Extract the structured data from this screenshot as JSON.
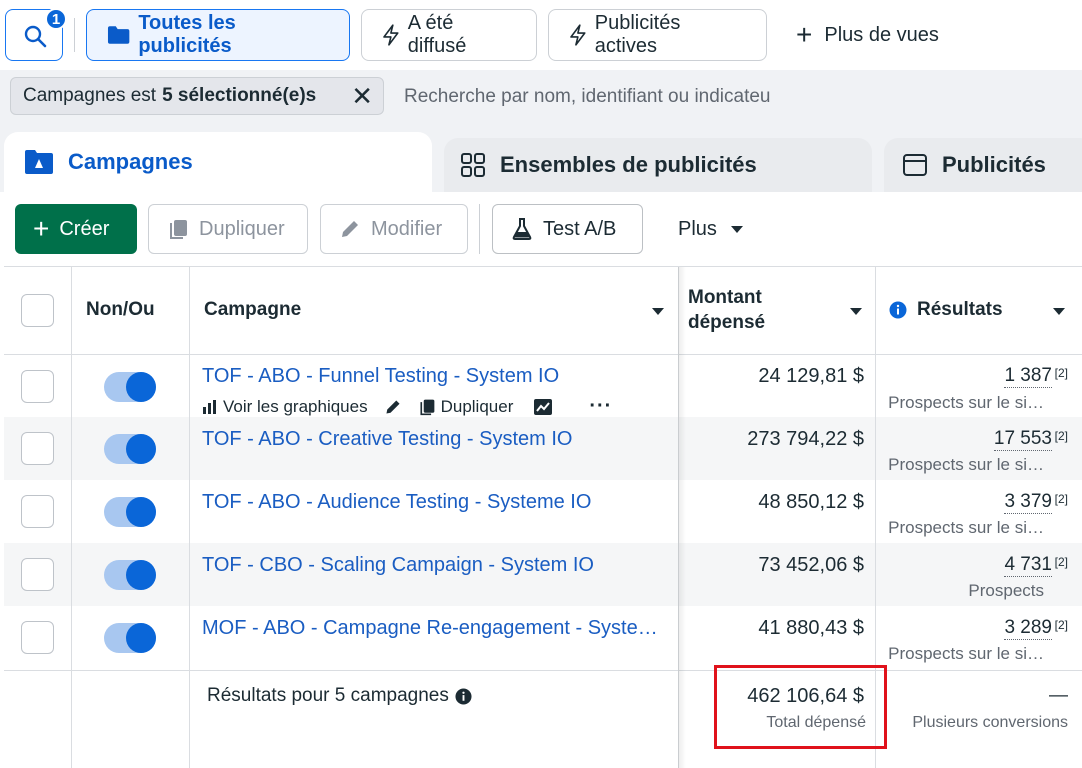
{
  "topbar": {
    "search_badge": "1",
    "views": [
      {
        "label": "Toutes les publicités",
        "icon": "folder-icon"
      },
      {
        "label": "A été diffusé",
        "icon": "lightning-icon"
      },
      {
        "label": "Publicités actives",
        "icon": "lightning-icon"
      }
    ],
    "more_views": "Plus de vues"
  },
  "filter": {
    "chip_prefix": "Campagnes est",
    "chip_value": "5 sélectionné(e)s",
    "search_placeholder": "Recherche par nom, identifiant ou indicateu"
  },
  "tabs": [
    {
      "label": "Campagnes",
      "icon": "campaign-icon",
      "active": true
    },
    {
      "label": "Ensembles de publicités",
      "icon": "grid-icon",
      "active": false
    },
    {
      "label": "Publicités",
      "icon": "ad-frame-icon",
      "active": false
    }
  ],
  "toolbar": {
    "create": "Créer",
    "duplicate": "Dupliquer",
    "edit": "Modifier",
    "ab_test": "Test A/B",
    "more": "Plus"
  },
  "table": {
    "columns": {
      "toggle": "Non/Ou",
      "campaign": "Campagne",
      "spent_line1": "Montant",
      "spent_line2": "dépensé",
      "results": "Résultats"
    },
    "row_actions": {
      "charts": "Voir les graphiques",
      "duplicate": "Dupliquer"
    },
    "rows": [
      {
        "name": "TOF - ABO - Funnel Testing - System IO",
        "spent": "24 129,81 $",
        "result": "1 387",
        "sup": "[2]",
        "result_label": "Prospects sur le si…",
        "on": true
      },
      {
        "name": "TOF - ABO - Creative Testing - System IO",
        "spent": "273 794,22 $",
        "result": "17 553",
        "sup": "[2]",
        "result_label": "Prospects sur le si…",
        "on": true
      },
      {
        "name": "TOF - ABO - Audience Testing - Systeme IO",
        "spent": "48 850,12 $",
        "result": "3 379",
        "sup": "[2]",
        "result_label": "Prospects sur le si…",
        "on": true
      },
      {
        "name": "TOF - CBO - Scaling Campaign - System IO",
        "spent": "73 452,06 $",
        "result": "4 731",
        "sup": "[2]",
        "result_label": "Prospects",
        "on": true
      },
      {
        "name": "MOF - ABO - Campagne Re-engagement - Syste…",
        "spent": "41 880,43 $",
        "result": "3 289",
        "sup": "[2]",
        "result_label": "Prospects sur le si…",
        "on": true
      }
    ],
    "footer": {
      "label": "Résultats pour 5 campagnes",
      "total": "462 106,64 $",
      "total_label": "Total dépensé",
      "results": "—",
      "results_label": "Plusieurs conversions"
    }
  },
  "colors": {
    "accent": "#0a66d8",
    "create_button": "#00704a",
    "link": "#1a5dc2",
    "highlight_box": "#e0121b"
  }
}
